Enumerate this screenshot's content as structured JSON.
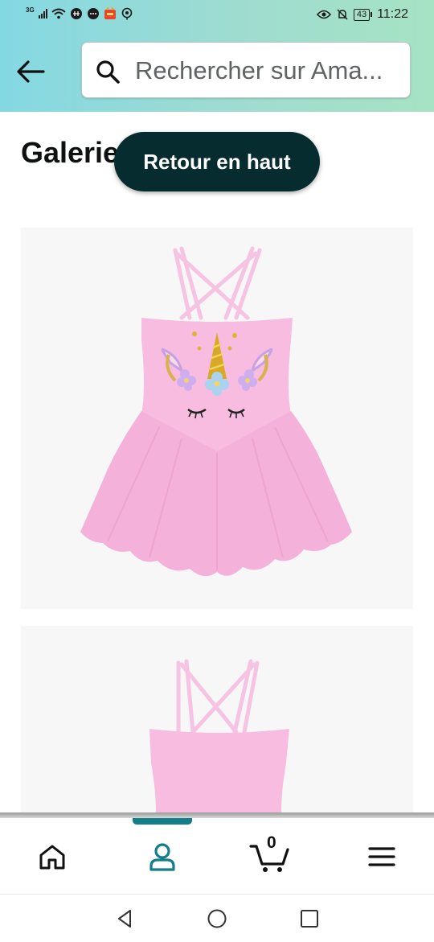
{
  "status_bar": {
    "network": "3G",
    "battery": "43",
    "time": "11:22"
  },
  "search": {
    "placeholder": "Rechercher sur Ama..."
  },
  "gallery": {
    "title": "Galerie produit"
  },
  "back_to_top": {
    "label": "Retour en haut"
  },
  "bottom_nav": {
    "cart_count": "0"
  },
  "colors": {
    "header_gradient_start": "#84d8e3",
    "header_gradient_end": "#a6e3c4",
    "back_to_top_bg": "#062c2f",
    "nav_active": "#117e8a",
    "dress_pink": "#f4b6dc"
  },
  "icons": [
    "back-arrow-icon",
    "search-icon",
    "home-icon",
    "account-icon",
    "cart-icon",
    "menu-icon",
    "system-back-icon",
    "system-home-icon",
    "system-recents-icon"
  ]
}
